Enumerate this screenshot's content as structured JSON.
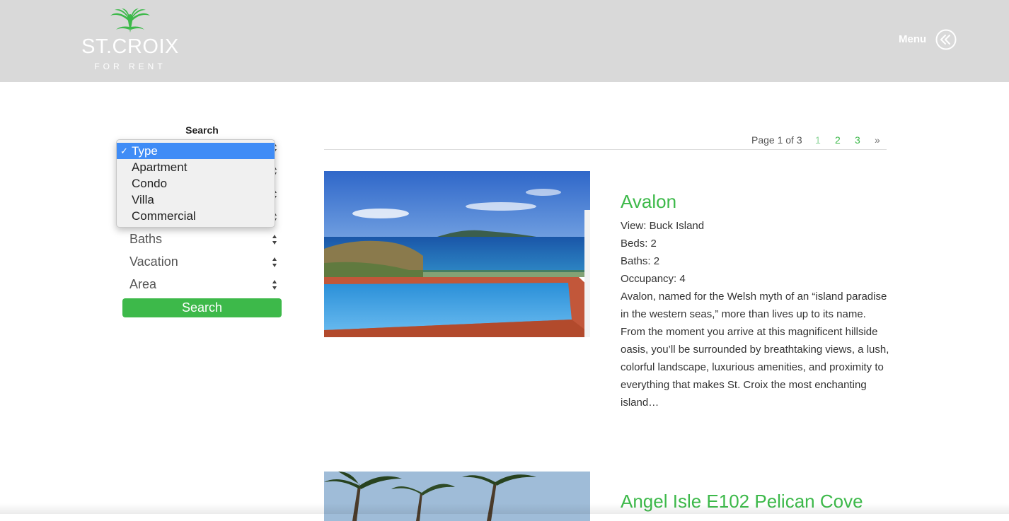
{
  "header": {
    "logo_text": "ST.CROIX",
    "logo_subtext": "FOR RENT",
    "menu_label": "Menu"
  },
  "sidebar": {
    "heading": "Search",
    "dropdown_options": [
      "Type",
      "Apartment",
      "Condo",
      "Villa",
      "Commercial"
    ],
    "dropdown_selected": "Type",
    "check_mark": "✓",
    "selects": [
      "Baths",
      "Vacation",
      "Area"
    ],
    "search_button": "Search"
  },
  "pagination": {
    "info": "Page 1 of 3",
    "pages": [
      "1",
      "2",
      "3"
    ],
    "current": "1",
    "next": "»"
  },
  "listings": [
    {
      "title": "Avalon",
      "view": "View: Buck Island",
      "beds": "Beds: 2",
      "baths": "Baths: 2",
      "occupancy": "Occupancy: 4",
      "description": "Avalon, named for the Welsh myth of an “island paradise in the western seas,” more than lives up to its name. From the moment you arrive at this magnificent hillside oasis, you’ll be surrounded by breathtaking views, a lush, colorful landscape, luxurious amenities, and proximity to everything that makes St. Croix the most enchanting island…"
    },
    {
      "title": "Angel Isle E102 Pelican Cove"
    }
  ],
  "colors": {
    "accent": "#3db94a",
    "header_bg": "#d9d9d9",
    "selected_option": "#3f8cf6"
  }
}
